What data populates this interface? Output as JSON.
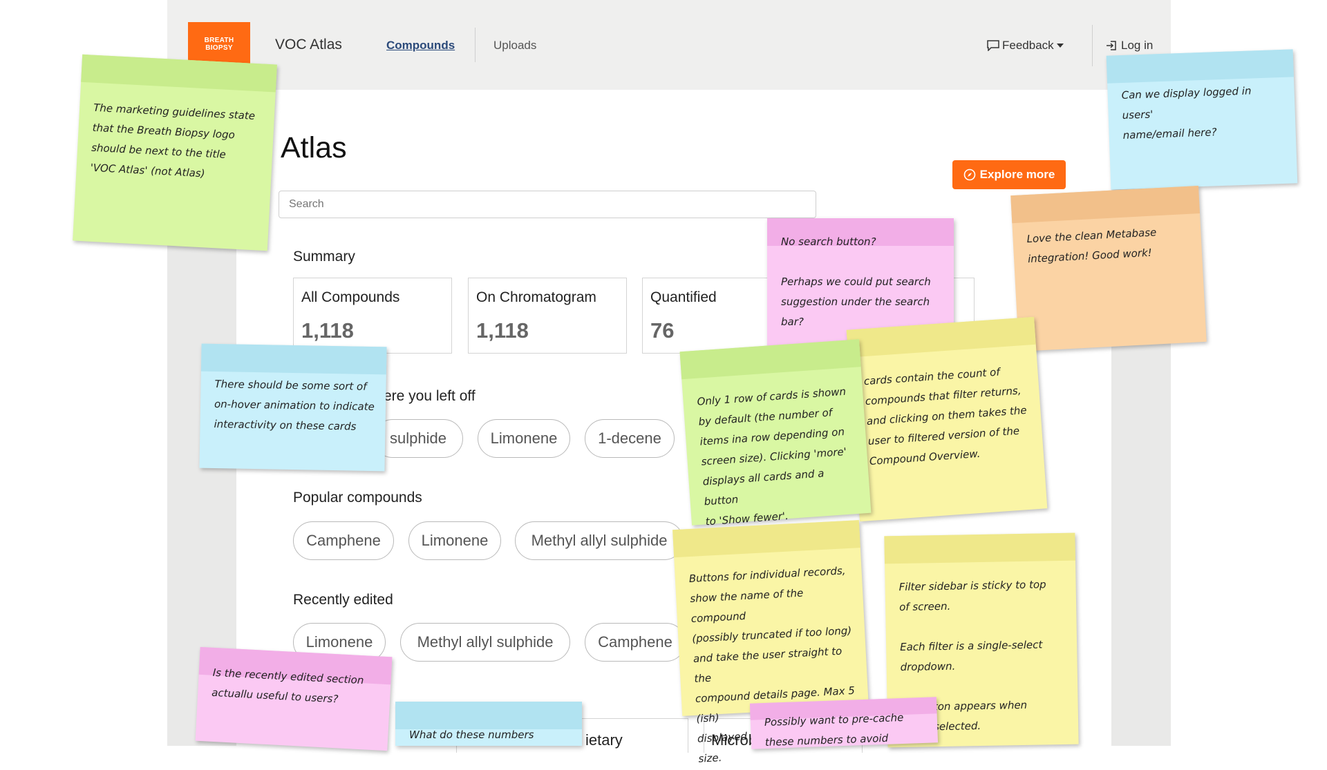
{
  "header": {
    "logo_line1": "BREATH",
    "logo_line2": "BIOPSY",
    "app_title": "VOC Atlas",
    "nav": {
      "compounds": "Compounds",
      "uploads": "Uploads"
    },
    "feedback": "Feedback",
    "login": "Log in"
  },
  "main": {
    "title": "Atlas",
    "explore_button": "Explore more",
    "search_placeholder": "Search",
    "summary": {
      "heading": "Summary",
      "cards": [
        {
          "title": "All Compounds",
          "value": "1,118"
        },
        {
          "title": "On Chromatogram",
          "value": "1,118"
        },
        {
          "title": "Quantified",
          "value": "76"
        }
      ]
    },
    "left_off": {
      "heading": "ere you left off",
      "items": [
        "sulphide",
        "Limonene",
        "1-decene"
      ]
    },
    "popular": {
      "heading": "Popular compounds",
      "items": [
        "Camphene",
        "Limonene",
        "Methyl allyl sulphide"
      ]
    },
    "recent": {
      "heading": "Recently edited",
      "items": [
        "Limonene",
        "Methyl allyl sulphide",
        "Camphene"
      ]
    },
    "bottom_cards": [
      "ietary",
      "Microb"
    ]
  },
  "notes": [
    {
      "text": "The marketing guidelines state\nthat the Breath Biopsy logo\nshould be next to the title\n'VOC Atlas' (not Atlas)",
      "color": "#d9f7a3",
      "band": "#c8ec8c"
    },
    {
      "text": "Can we display logged in users'\nname/email here?",
      "color": "#c9f0fb",
      "band": "#b1e3f1"
    },
    {
      "text": "No search button?\n\nPerhaps we could put search\nsuggestion under the search\nbar?",
      "color": "#fbc9f3",
      "band": "#f2aee7"
    },
    {
      "text": "Love the clean Metabase\nintegration! Good work!",
      "color": "#fbd3a4",
      "band": "#f2c08a"
    },
    {
      "text": "There should be some sort of\non-hover animation to indicate\ninteractivity on these cards",
      "color": "#c9f0fb",
      "band": "#b1e3f1"
    },
    {
      "text": "Only 1 row of cards is shown\nby default (the number of\nitems ina row depending on\nscreen size). Clicking 'more'\ndisplays all cards and a button\nto 'Show fewer'.",
      "color": "#d9f7a3",
      "band": "#c8ec8c"
    },
    {
      "text": "cards contain the count of\ncompounds that filter returns,\nand clicking on them takes the\nuser to filtered version of the\nCompound Overview.",
      "color": "#faf5a6",
      "band": "#efe88a"
    },
    {
      "text": "Buttons for individual records,\nshow the name of the compound\n(possibly truncated if too long)\nand take the user straight to the\ncompound details page. Max 5 (ish)\ndisplayed depending on screen size.",
      "color": "#faf5a6",
      "band": "#efe88a"
    },
    {
      "text": "Filter sidebar is sticky to top\nof screen.\n\nEach filter is a single-select\ndropdown.\n\nall button appears when\nlter is selected.",
      "color": "#faf5a6",
      "band": "#efe88a"
    },
    {
      "text": "Is the recently edited section\nactuallu useful to users?",
      "color": "#fbc9f3",
      "band": "#f2aee7"
    },
    {
      "text": "What do these numbers",
      "color": "#c9f0fb",
      "band": "#b1e3f1"
    },
    {
      "text": "Possibly want to pre-cache\nthese numbers to avoid",
      "color": "#fbc9f3",
      "band": "#f2aee7"
    }
  ]
}
